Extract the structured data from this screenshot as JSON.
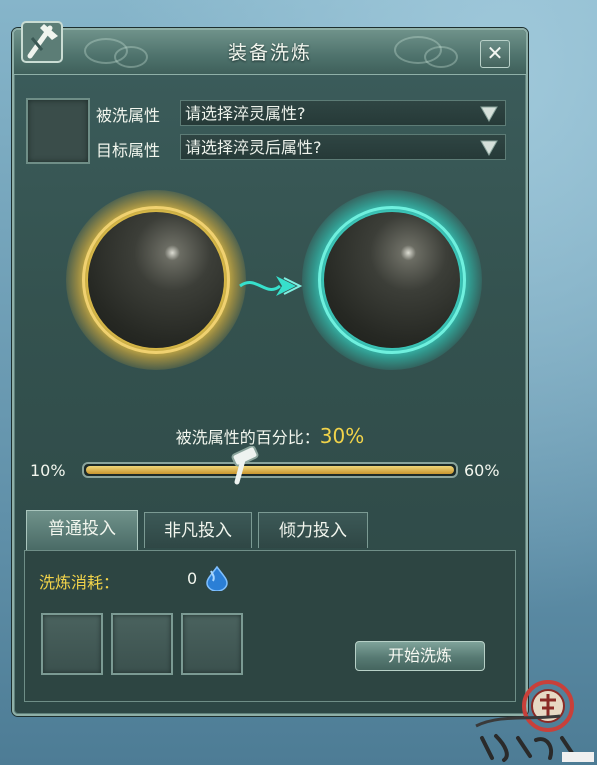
{
  "dialog": {
    "title": "装备洗炼",
    "close_label": "✕"
  },
  "attributes": {
    "source_label": "被洗属性",
    "source_placeholder": "请选择淬灵属性?",
    "target_label": "目标属性",
    "target_placeholder": "请选择淬灵后属性?"
  },
  "percentage": {
    "label": "被洗属性的百分比：",
    "value": "30%",
    "min_label": "10%",
    "max_label": "60%",
    "fill_fraction": 0.4
  },
  "tabs": [
    {
      "label": "普通投入",
      "active": true
    },
    {
      "label": "非凡投入",
      "active": false
    },
    {
      "label": "倾力投入",
      "active": false
    }
  ],
  "cost": {
    "label": "洗炼消耗：",
    "value": "0",
    "icon": "water-drop-icon"
  },
  "actions": {
    "start_label": "开始洗炼"
  },
  "colors": {
    "accent_gold": "#f1d34a",
    "orb_gold_glow": "#e0b23a",
    "orb_teal_glow": "#2fd6c4"
  }
}
